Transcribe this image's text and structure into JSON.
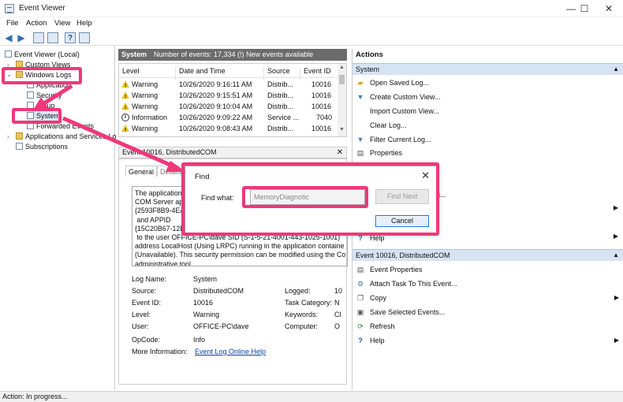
{
  "window": {
    "title": "Event Viewer",
    "minimize": "—",
    "maximize": "☐",
    "close": "✕"
  },
  "menu": [
    "File",
    "Action",
    "View",
    "Help"
  ],
  "tree": {
    "root": "Event Viewer (Local)",
    "custom_views": "Custom Views",
    "windows_logs": "Windows Logs",
    "application": "Application",
    "security": "Security",
    "setup": "Setup",
    "system": "System",
    "forwarded": "Forwarded Events",
    "app_services": "Applications and Services Lo",
    "subscriptions": "Subscriptions"
  },
  "center": {
    "log_name": "System",
    "event_count": "Number of events: 17,334 (!) New events available",
    "columns": [
      "Level",
      "Date and Time",
      "Source",
      "Event ID"
    ],
    "rows": [
      {
        "level": "Warning",
        "date": "10/26/2020 9:16:11 AM",
        "source": "Distrib...",
        "id": "10016",
        "icon": "warning"
      },
      {
        "level": "Warning",
        "date": "10/26/2020 9:15:51 AM",
        "source": "Distrib...",
        "id": "10016",
        "icon": "warning"
      },
      {
        "level": "Warning",
        "date": "10/26/2020 9:10:04 AM",
        "source": "Distrib...",
        "id": "10016",
        "icon": "warning"
      },
      {
        "level": "Information",
        "date": "10/26/2020 9:09:22 AM",
        "source": "Service ...",
        "id": "7040",
        "icon": "info"
      },
      {
        "level": "Warning",
        "date": "10/26/2020 9:08:43 AM",
        "source": "Distrib...",
        "id": "10016",
        "icon": "warning"
      }
    ]
  },
  "detail": {
    "header": "Event 10016, DistributedCOM",
    "tab_general": "General",
    "tab_details": "Details",
    "text": "The application-s\nCOM Server appli\n{2593F8B9-4EAF-4\n and APPID\n{15C20B67-12E7-4\n to the user OFFICE-PC\\dave SID (S-1-5-21-4001-443-1025-1001)\naddress LocalHost (Using LRPC) running in the application containe\n(Unavailable). This security permission can be modified using the Co\nadministrative tool.",
    "fields": {
      "log_name_label": "Log Name:",
      "log_name": "System",
      "source_label": "Source:",
      "source": "DistributedCOM",
      "logged_label": "Logged:",
      "logged": "10",
      "event_id_label": "Event ID:",
      "event_id": "10016",
      "task_label": "Task Category:",
      "task": "N",
      "level_label": "Level:",
      "level": "Warning",
      "keywords_label": "Keywords:",
      "keywords": "Cl",
      "user_label": "User:",
      "user": "OFFICE-PC\\dave",
      "computer_label": "Computer:",
      "computer": "O",
      "opcode_label": "OpCode:",
      "opcode": "Info",
      "more_label": "More Information:",
      "more_link": "Event Log Online Help"
    }
  },
  "actions": {
    "title": "Actions",
    "system_section": "System",
    "system_items": [
      {
        "label": "Open Saved Log...",
        "icon": "folder-open-icon",
        "glyph": "📂"
      },
      {
        "label": "Create Custom View...",
        "icon": "filter-icon",
        "glyph": "▼"
      },
      {
        "label": "Import Custom View...",
        "icon": "blank-icon",
        "glyph": ""
      },
      {
        "label": "Clear Log...",
        "icon": "blank-icon",
        "glyph": ""
      },
      {
        "label": "Filter Current Log...",
        "icon": "filter-icon",
        "glyph": "▼"
      },
      {
        "label": "Properties",
        "icon": "properties-icon",
        "glyph": "▤"
      }
    ],
    "partial_1": "g...",
    "help": "Help",
    "event_section": "Event 10016, DistributedCOM",
    "event_items": [
      {
        "label": "Event Properties",
        "icon": "event-properties-icon",
        "glyph": "▤"
      },
      {
        "label": "Attach Task To This Event...",
        "icon": "attach-task-icon",
        "glyph": "⚙"
      },
      {
        "label": "Copy",
        "icon": "copy-icon",
        "glyph": "⧉"
      },
      {
        "label": "Save Selected Events...",
        "icon": "save-icon",
        "glyph": "▣"
      },
      {
        "label": "Refresh",
        "icon": "refresh-icon",
        "glyph": "⟳"
      },
      {
        "label": "Help",
        "icon": "help-icon",
        "glyph": "?"
      }
    ]
  },
  "find": {
    "title": "Find",
    "label": "Find what:",
    "value": "MemoryDiagnotic",
    "find_next": "Find Next",
    "cancel": "Cancel"
  },
  "status": "Action:  In progress...",
  "colors": {
    "annotation": "#f0377a",
    "section": "#d6e3f3"
  }
}
